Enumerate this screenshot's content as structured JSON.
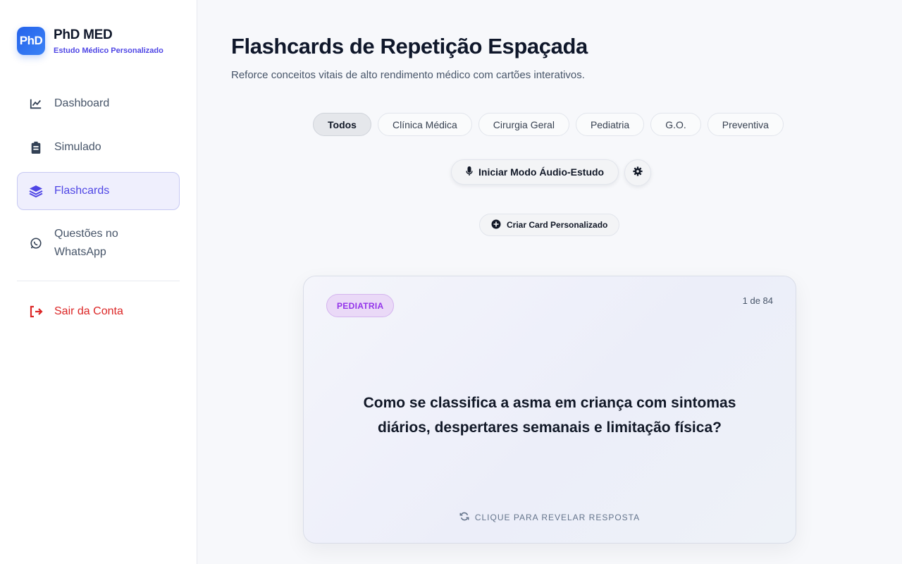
{
  "brand": {
    "logo_text": "PhD",
    "name": "PhD MED",
    "subtitle": "Estudo Médico Personalizado"
  },
  "sidebar": {
    "items": [
      {
        "label": "Dashboard",
        "icon": "chart-line-icon"
      },
      {
        "label": "Simulado",
        "icon": "clipboard-icon"
      },
      {
        "label": "Flashcards",
        "icon": "layers-icon",
        "active": true
      },
      {
        "label": "Questões no WhatsApp",
        "icon": "whatsapp-icon"
      }
    ],
    "logout": {
      "label": "Sair da Conta",
      "icon": "logout-icon"
    }
  },
  "header": {
    "title": "Flashcards de Repetição Espaçada",
    "subtitle": "Reforce conceitos vitais de alto rendimento médico com cartões interativos."
  },
  "filters": [
    {
      "label": "Todos",
      "active": true
    },
    {
      "label": "Clínica Médica"
    },
    {
      "label": "Cirurgia Geral"
    },
    {
      "label": "Pediatria"
    },
    {
      "label": "G.O."
    },
    {
      "label": "Preventiva"
    }
  ],
  "actions": {
    "audio_label": "Iniciar Modo Áudio-Estudo",
    "create_label": "Criar Card Personalizado"
  },
  "card": {
    "category": "PEDIATRIA",
    "counter": "1 de 84",
    "question": "Como se classifica a asma em criança com sintomas diários, despertares semanais e limitação física?",
    "reveal_label": "CLIQUE PARA REVELAR RESPOSTA"
  },
  "colors": {
    "accent": "#4f46e5",
    "logout": "#dc2626",
    "badge": "#9333ea"
  }
}
